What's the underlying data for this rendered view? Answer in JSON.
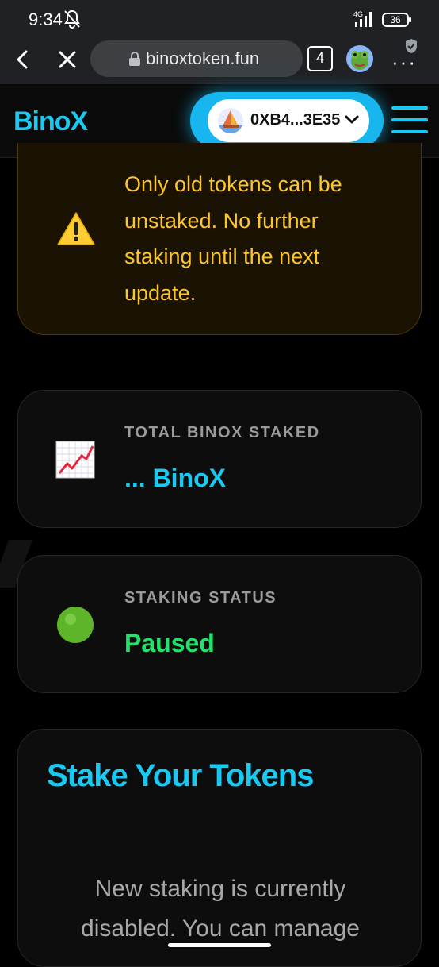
{
  "status_bar": {
    "time": "9:34",
    "battery": "36",
    "network": "4G"
  },
  "browser": {
    "url": "binoxtoken.fun",
    "tab_count": "4"
  },
  "header": {
    "logo": "BinoX",
    "wallet_address": "0XB4...3E35",
    "accent_color": "#19c9f2"
  },
  "warning": {
    "icon": "warning-icon",
    "text": "Only old tokens can be unstaked. No further staking until the next update."
  },
  "stats": {
    "staked": {
      "icon": "chart-increasing-icon",
      "label": "TOTAL BINOX STAKED",
      "value": "... BinoX"
    },
    "status": {
      "icon": "green-circle-icon",
      "label": "STAKING STATUS",
      "value": "Paused"
    }
  },
  "stake_section": {
    "title": "Stake Your Tokens",
    "description": "New staking is currently disabled. You can manage"
  }
}
